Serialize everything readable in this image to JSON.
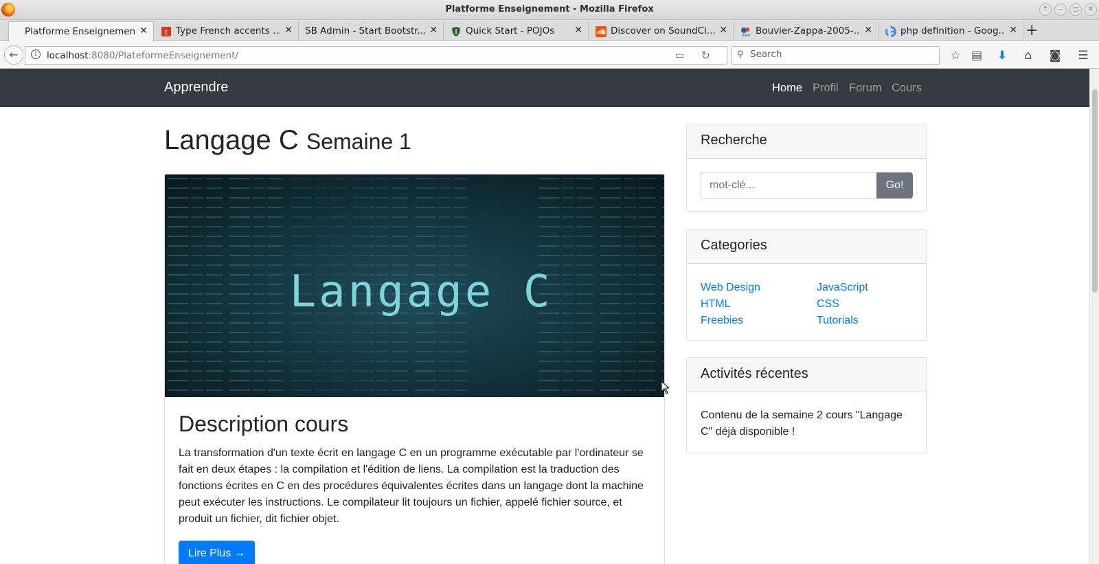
{
  "window": {
    "title": "Platforme Enseignement - Mozilla Firefox"
  },
  "tabs": [
    {
      "label": "Platforme Enseignement",
      "active": true,
      "icon": "none"
    },
    {
      "label": "Type French accents ...",
      "active": false,
      "icon": "red-t-icon"
    },
    {
      "label": "SB Admin - Start Bootstr...",
      "active": false,
      "icon": "none"
    },
    {
      "label": "Quick Start - POJOs",
      "active": false,
      "icon": "shield-favicon"
    },
    {
      "label": "Discover on SoundCl...",
      "active": false,
      "icon": "soundcloud-icon"
    },
    {
      "label": "Bouvier-Zappa-2005-...",
      "active": false,
      "icon": "diro-icon"
    },
    {
      "label": "php definition - Goog...",
      "active": false,
      "icon": "google-icon"
    }
  ],
  "urlbar": {
    "host": "localhost",
    "path": ":8080/PlateformeEnseignement/"
  },
  "searchbar": {
    "placeholder": "Search"
  },
  "site": {
    "brand": "Apprendre",
    "nav": [
      "Home",
      "Profil",
      "Forum",
      "Cours"
    ],
    "active_nav": "Home"
  },
  "main": {
    "title": "Langage C",
    "subtitle": "Semaine 1",
    "banner_text": "Langage C",
    "desc_title": "Description cours",
    "desc_text": "La transformation d'un texte écrit en langage C en un programme exécutable par l'ordinateur se fait en deux étapes : la compilation et l'édition de liens. La compilation est la traduction des fonctions écrites en C en des procédures équivalentes écrites dans un langage dont la machine peut exécuter les instructions. Le compilateur lit toujours un fichier, appelé fichier source, et produit un fichier, dit fichier objet.",
    "read_more": "Lire Plus →"
  },
  "sidebar": {
    "search": {
      "title": "Recherche",
      "placeholder": "mot-clé...",
      "button": "Go!"
    },
    "categories": {
      "title": "Categories",
      "left": [
        "Web Design",
        "HTML",
        "Freebies"
      ],
      "right": [
        "JavaScript",
        "CSS",
        "Tutorials"
      ]
    },
    "activity": {
      "title": "Activités récentes",
      "text": "Contenu de la semaine 2 cours \"Langage C\" déjà disponible !"
    }
  },
  "colors": {
    "navbar": "#343a40",
    "primary": "#007bff",
    "secondary": "#6c757d"
  }
}
